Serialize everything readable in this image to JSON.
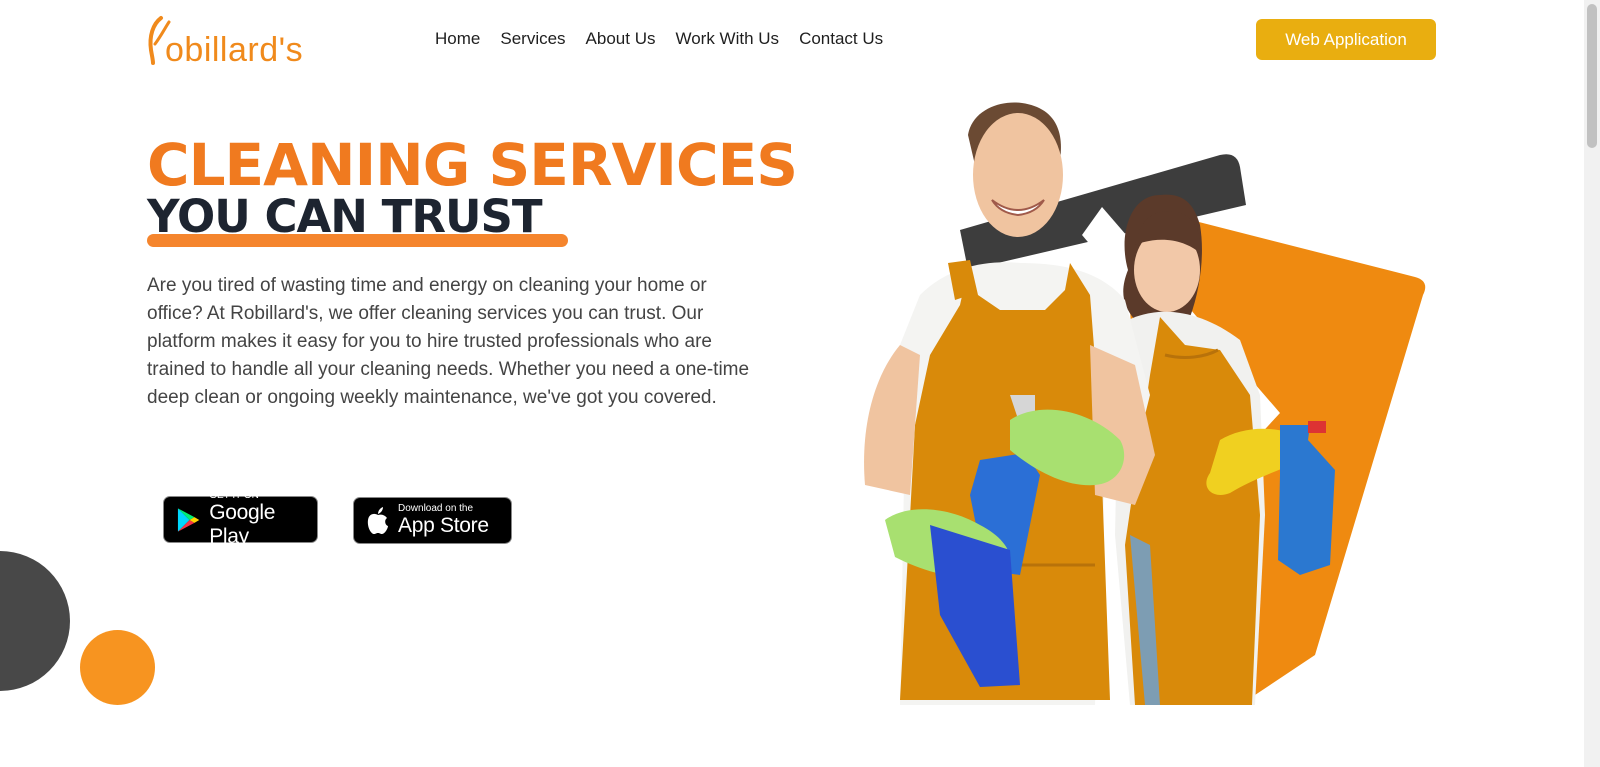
{
  "brand": {
    "logo_text": "obillard's",
    "logo_color": "#f08a1c"
  },
  "nav": {
    "items": [
      {
        "label": "Home"
      },
      {
        "label": "Services"
      },
      {
        "label": "About Us"
      },
      {
        "label": "Work With Us"
      },
      {
        "label": "Contact Us"
      }
    ]
  },
  "header": {
    "cta_label": "Web Application",
    "cta_color": "#e9ae10"
  },
  "hero": {
    "title_line1": "CLEANING SERVICES",
    "title_line2": "YOU CAN TRUST",
    "description": "Are you tired of wasting time and energy on cleaning your home or office? At Robillard's, we offer cleaning services you can trust. Our platform makes it easy for you to hire trusted professionals who are trained to handle all your cleaning needs. Whether you need a one-time deep clean or ongoing weekly maintenance, we've got you covered.",
    "accent_color": "#f07a1f",
    "dark_color": "#1d2430"
  },
  "stores": {
    "google": {
      "small": "GET IT ON",
      "big": "Google Play",
      "icon": "google-play-icon"
    },
    "apple": {
      "small": "Download on the",
      "big": "App Store",
      "icon": "apple-icon"
    }
  }
}
